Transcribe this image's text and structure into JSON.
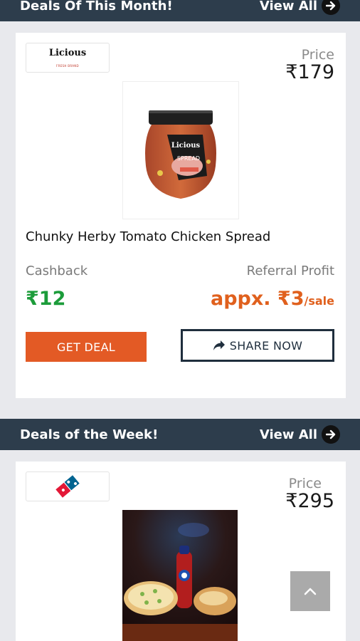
{
  "sections": [
    {
      "title": "Deals Of This Month!",
      "view_all": "View All",
      "deal": {
        "brand": "Licious",
        "brand_sub": "FRESH BRAND",
        "price_label": "Price",
        "price": "₹179",
        "product_name": "Chunky Herby Tomato Chicken Spread",
        "jar_brand": "Licious",
        "jar_text": "SPREAD",
        "cashback_label": "Cashback",
        "cashback_value": "₹12",
        "referral_label": "Referral Profit",
        "referral_value": "appx. ₹3",
        "referral_unit": "/sale",
        "get_deal": "GET DEAL",
        "share_now": "SHARE NOW"
      }
    },
    {
      "title": "Deals of the Week!",
      "view_all": "View All",
      "deal": {
        "brand": "Domino's",
        "price_label": "Price",
        "price": "₹295"
      }
    }
  ],
  "icons": {
    "view_all_arrow": "arrow-right-icon",
    "share": "share-icon",
    "scroll_top": "chevron-up-icon"
  },
  "colors": {
    "header_bg": "#2d3d4c",
    "cashback": "#1c9c3a",
    "referral": "#e0601d",
    "get_deal_bg": "#e35a25",
    "share_border": "#1f2e3d"
  }
}
